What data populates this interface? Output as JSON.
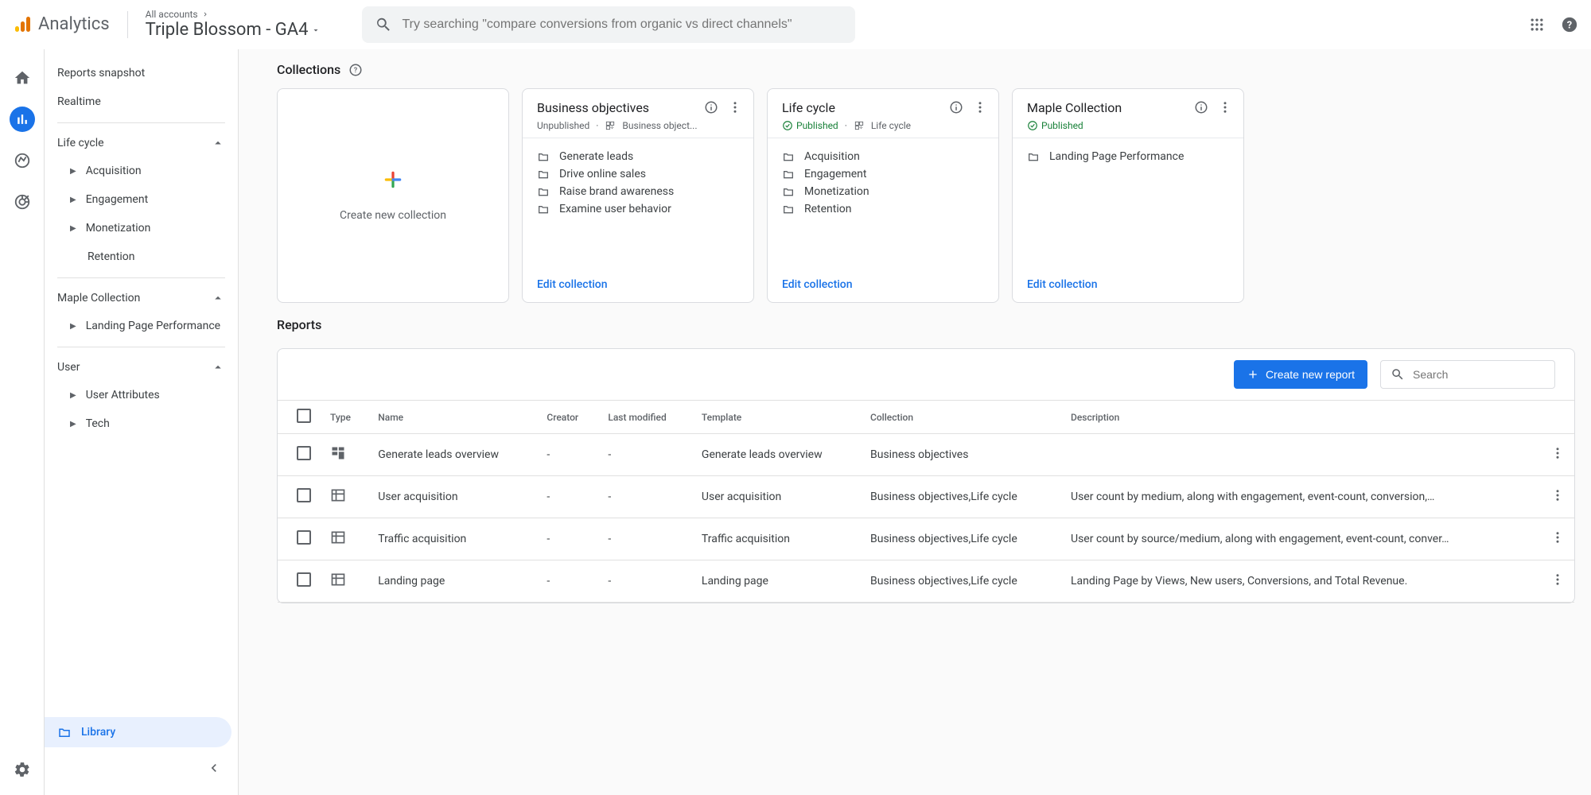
{
  "header": {
    "logo_text": "Analytics",
    "breadcrumb": "All accounts",
    "account_name": "Triple Blossom - GA4",
    "search_placeholder": "Try searching \"compare conversions from organic vs direct channels\""
  },
  "sidebar": {
    "reports_snapshot": "Reports snapshot",
    "realtime": "Realtime",
    "sections": [
      {
        "label": "Life cycle",
        "children": [
          "Acquisition",
          "Engagement",
          "Monetization",
          "Retention"
        ]
      },
      {
        "label": "Maple Collection",
        "children": [
          "Landing Page Performance"
        ]
      },
      {
        "label": "User",
        "children": [
          "User Attributes",
          "Tech"
        ]
      }
    ],
    "library_label": "Library"
  },
  "collections": {
    "title": "Collections",
    "create_label": "Create new collection",
    "edit_label": "Edit collection",
    "cards": [
      {
        "title": "Business objectives",
        "status": "Unpublished",
        "template": "Business object...",
        "items": [
          "Generate leads",
          "Drive online sales",
          "Raise brand awareness",
          "Examine user behavior"
        ]
      },
      {
        "title": "Life cycle",
        "status": "Published",
        "template": "Life cycle",
        "items": [
          "Acquisition",
          "Engagement",
          "Monetization",
          "Retention"
        ]
      },
      {
        "title": "Maple Collection",
        "status": "Published",
        "template": "",
        "items": [
          "Landing Page Performance"
        ]
      }
    ]
  },
  "reports": {
    "title": "Reports",
    "create_button": "Create new report",
    "search_placeholder": "Search",
    "columns": [
      "Type",
      "Name",
      "Creator",
      "Last modified",
      "Template",
      "Collection",
      "Description"
    ],
    "rows": [
      {
        "name": "Generate leads overview",
        "creator": "-",
        "modified": "-",
        "template": "Generate leads overview",
        "collection": "Business objectives",
        "description": "",
        "icon": "overview"
      },
      {
        "name": "User acquisition",
        "creator": "-",
        "modified": "-",
        "template": "User acquisition",
        "collection": "Business objectives,Life cycle",
        "description": "User count by medium, along with engagement, event-count, conversion,…",
        "icon": "detail"
      },
      {
        "name": "Traffic acquisition",
        "creator": "-",
        "modified": "-",
        "template": "Traffic acquisition",
        "collection": "Business objectives,Life cycle",
        "description": "User count by source/medium, along with engagement, event-count, conver…",
        "icon": "detail"
      },
      {
        "name": "Landing page",
        "creator": "-",
        "modified": "-",
        "template": "Landing page",
        "collection": "Business objectives,Life cycle",
        "description": "Landing Page by Views, New users, Conversions, and Total Revenue.",
        "icon": "detail"
      }
    ]
  }
}
